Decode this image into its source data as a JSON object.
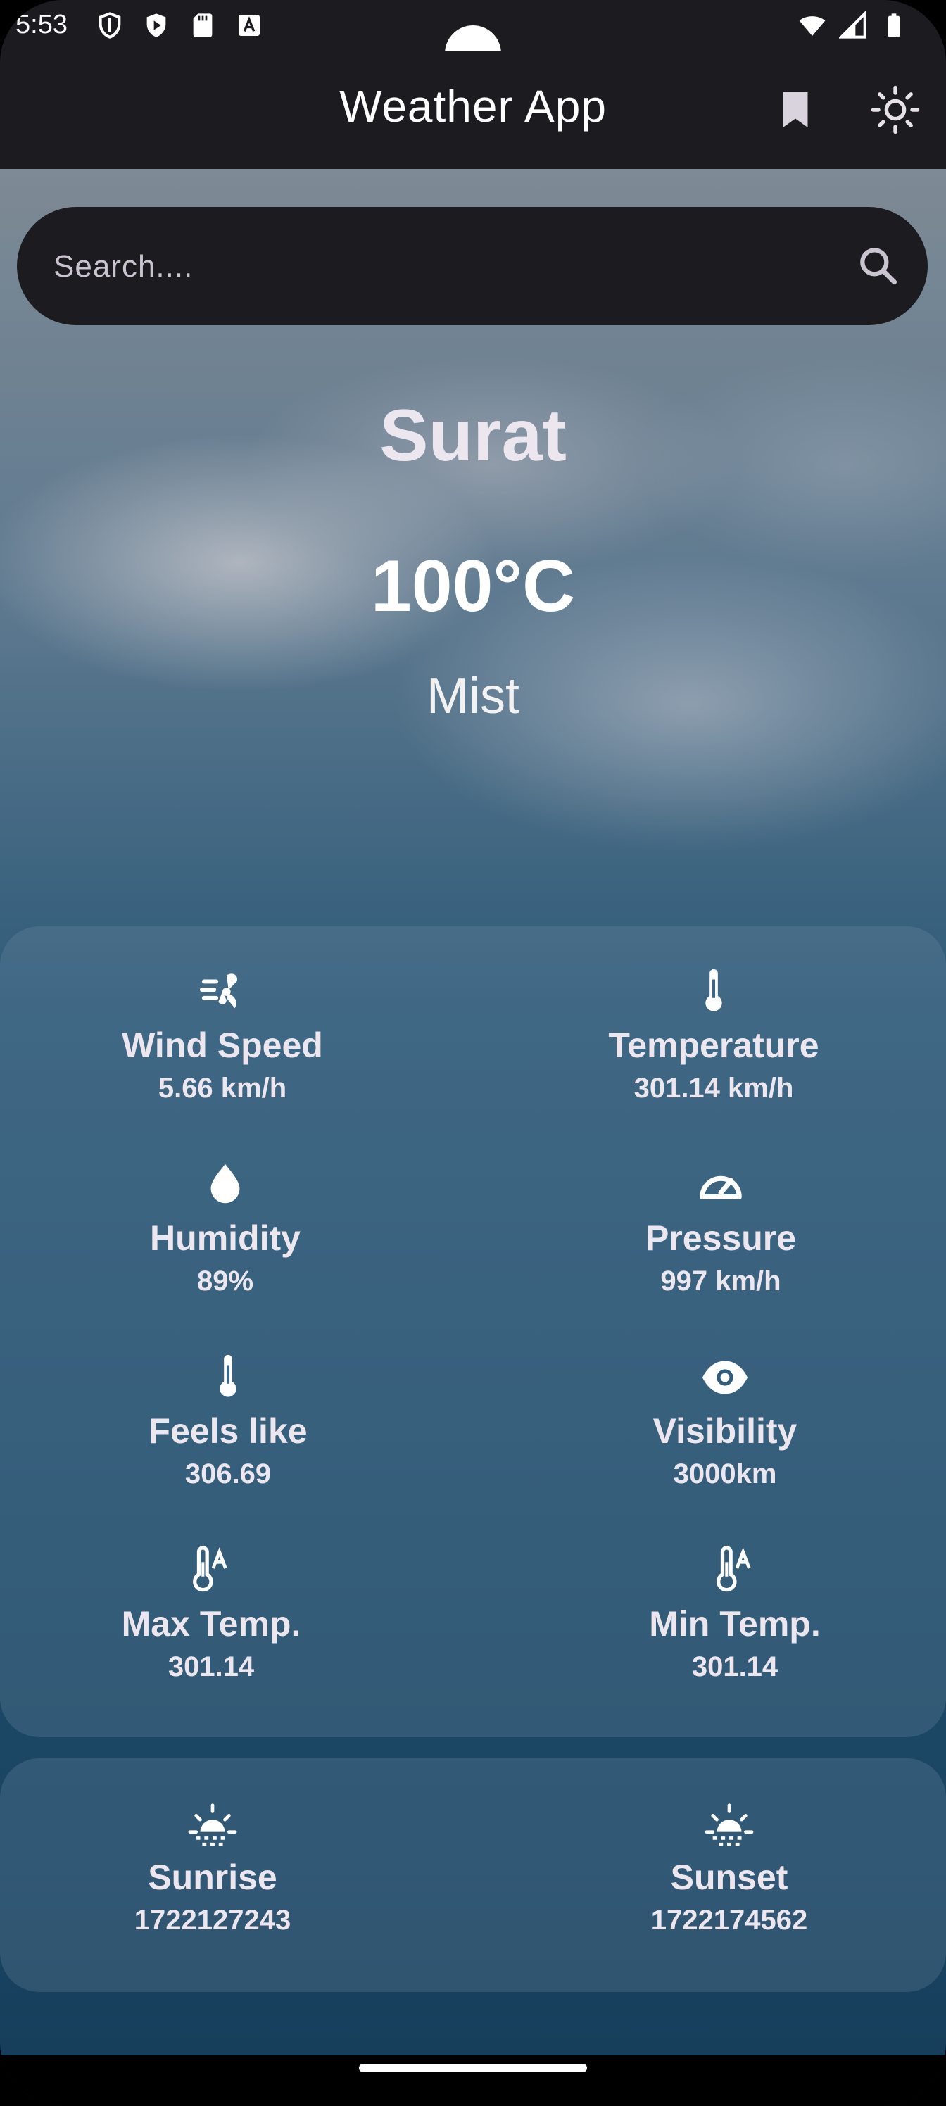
{
  "status_bar": {
    "time": "5:53",
    "left_icons": [
      "shield-icon",
      "play-protect-icon",
      "sd-card-icon",
      "keyboard-a-icon"
    ],
    "right_icons": [
      "wifi-icon",
      "cellular-signal-icon",
      "battery-icon"
    ]
  },
  "app_bar": {
    "title": "Weather App",
    "actions": [
      "bookmark-icon",
      "brightness-icon"
    ]
  },
  "search": {
    "placeholder": "Search....",
    "value": ""
  },
  "weather": {
    "city": "Surat",
    "temperature": "100°C",
    "condition": "Mist"
  },
  "details": [
    {
      "icon": "wind-icon",
      "label": "Wind Speed",
      "value": "5.66 km/h"
    },
    {
      "icon": "thermometer-icon",
      "label": "Temperature",
      "value": "301.14 km/h"
    },
    {
      "icon": "humidity-drop-icon",
      "label": "Humidity",
      "value": "89%"
    },
    {
      "icon": "pressure-gauge-icon",
      "label": "Pressure",
      "value": "997 km/h"
    },
    {
      "icon": "thermometer-icon",
      "label": "Feels like",
      "value": "306.69"
    },
    {
      "icon": "eye-icon",
      "label": "Visibility",
      "value": "3000km"
    },
    {
      "icon": "thermometer-auto-icon",
      "label": "Max Temp.",
      "value": "301.14"
    },
    {
      "icon": "thermometer-auto-icon",
      "label": "Min Temp.",
      "value": "301.14"
    }
  ],
  "sun": [
    {
      "icon": "sunrise-icon",
      "label": "Sunrise",
      "value": "1722127243"
    },
    {
      "icon": "sunset-icon",
      "label": "Sunset",
      "value": "1722174562"
    }
  ],
  "colors": {
    "app_bar": "#1c1b20",
    "text_primary": "#ece6ef",
    "card_overlay": "#6e8ca5"
  }
}
